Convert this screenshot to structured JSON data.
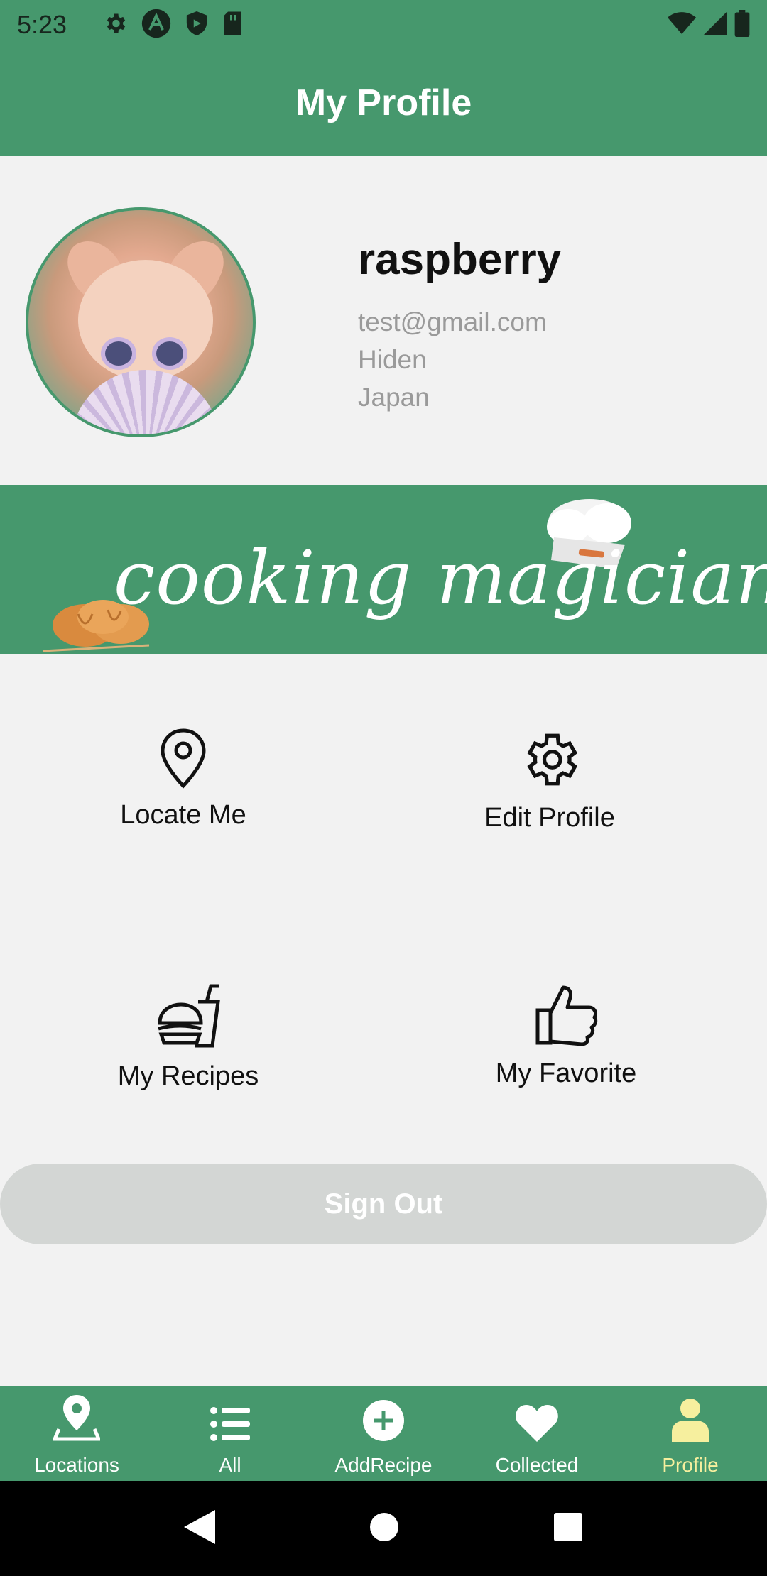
{
  "status_bar": {
    "time": "5:23",
    "icons": [
      "settings-icon",
      "android-icon",
      "shield-icon",
      "sd-card-icon"
    ],
    "right_icons": [
      "wifi-icon",
      "signal-icon",
      "battery-icon"
    ]
  },
  "app_bar": {
    "title": "My Profile"
  },
  "profile": {
    "name": "raspberry",
    "email": "test@gmail.com",
    "gender": "Hiden",
    "country": "Japan"
  },
  "banner": {
    "slogan": "cooking magician"
  },
  "menu": {
    "locate_me": "Locate Me",
    "edit_profile": "Edit Profile",
    "my_recipes": "My Recipes",
    "my_favorite": "My Favorite"
  },
  "sign_out": {
    "label": "Sign Out"
  },
  "bottom_nav": {
    "items": [
      {
        "label": "Locations",
        "icon": "location-pin-icon"
      },
      {
        "label": "All",
        "icon": "list-icon"
      },
      {
        "label": "AddRecipe",
        "icon": "add-circle-icon"
      },
      {
        "label": "Collected",
        "icon": "heart-icon"
      },
      {
        "label": "Profile",
        "icon": "person-icon"
      }
    ],
    "active": "Profile"
  },
  "colors": {
    "primary": "#46986d",
    "active_nav": "#f6ef9e",
    "sign_out_bg": "#d3d6d4",
    "background": "#f2f2f2"
  }
}
